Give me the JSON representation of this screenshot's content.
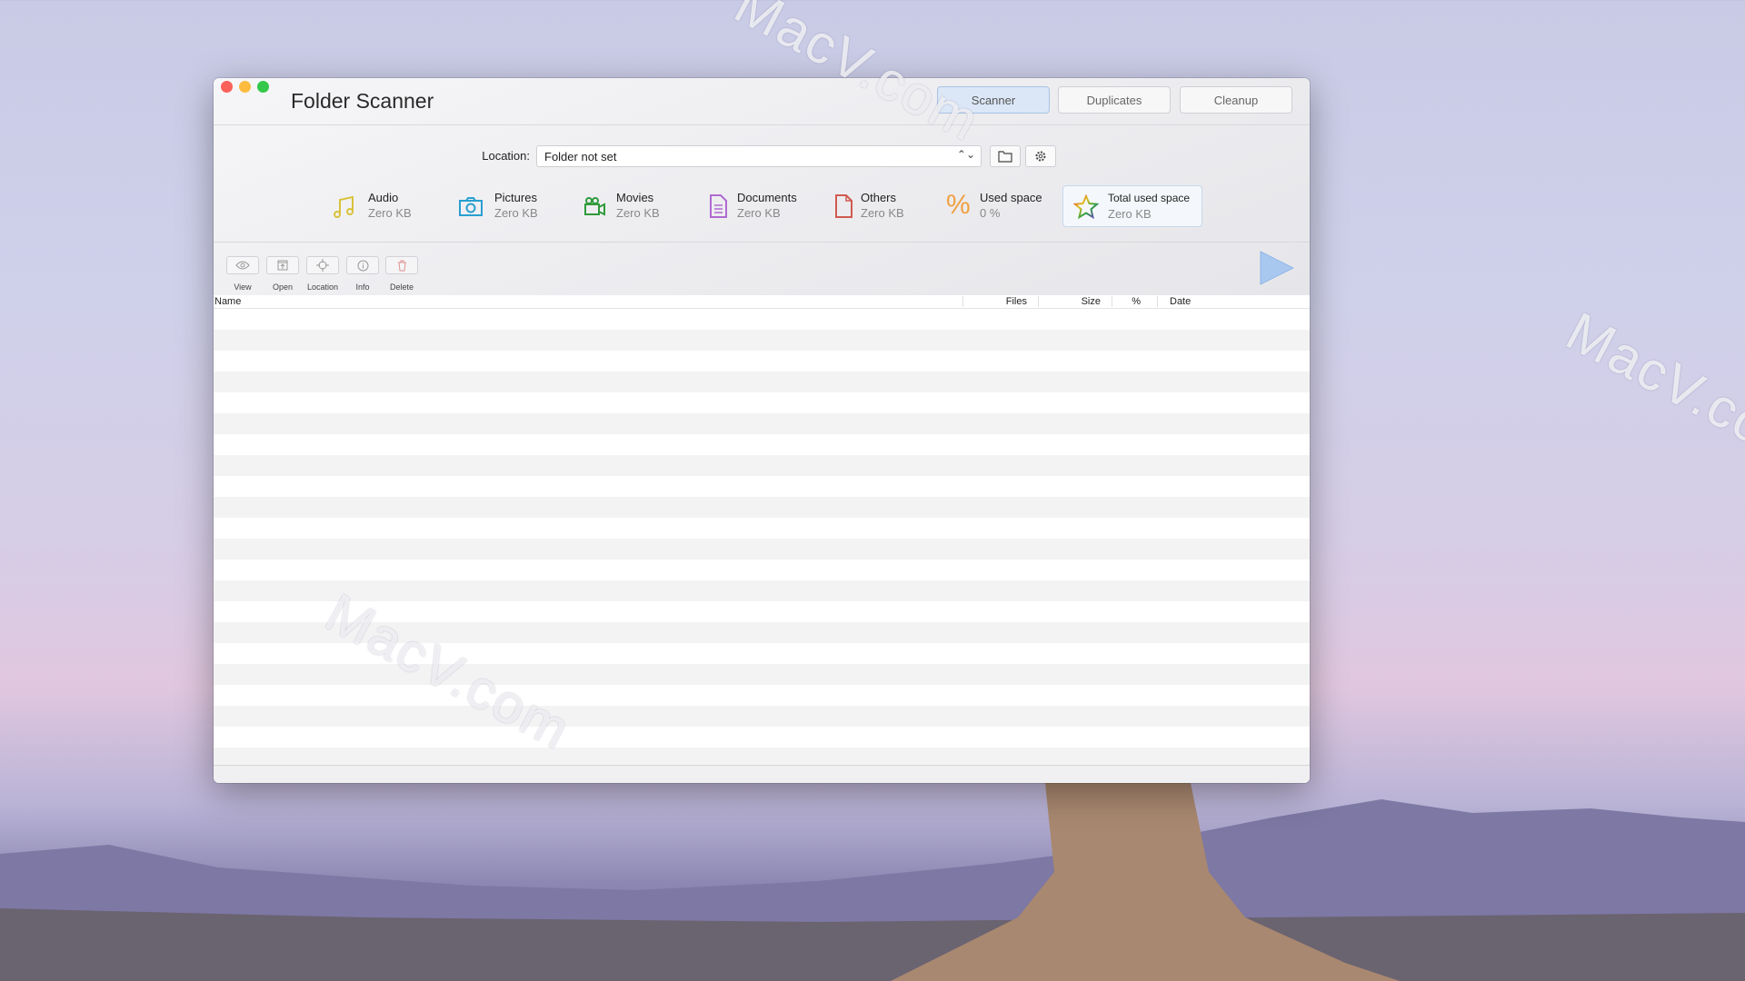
{
  "window": {
    "title": "Folder Scanner"
  },
  "tabs": [
    {
      "label": "Scanner",
      "active": true
    },
    {
      "label": "Duplicates",
      "active": false
    },
    {
      "label": "Cleanup",
      "active": false
    }
  ],
  "location": {
    "label": "Location:",
    "value": "Folder not set"
  },
  "categories": [
    {
      "name": "Audio",
      "value": "Zero KB",
      "icon": "music-note-icon",
      "color": "#d8c23a"
    },
    {
      "name": "Pictures",
      "value": "Zero KB",
      "icon": "camera-icon",
      "color": "#2a9fd0"
    },
    {
      "name": "Movies",
      "value": "Zero KB",
      "icon": "video-camera-icon",
      "color": "#2f9a3a"
    },
    {
      "name": "Documents",
      "value": "Zero KB",
      "icon": "document-icon",
      "color": "#b06ad0"
    },
    {
      "name": "Others",
      "value": "Zero KB",
      "icon": "file-icon",
      "color": "#d05a50"
    },
    {
      "name": "Used space",
      "value": "0 %",
      "icon": "percent-icon",
      "color": "#f0a040"
    },
    {
      "name": "Total used space",
      "value": "Zero KB",
      "icon": "star-icon",
      "color": "#e04040"
    }
  ],
  "toolbar": [
    {
      "label": "View",
      "icon": "eye-icon"
    },
    {
      "label": "Open",
      "icon": "open-icon"
    },
    {
      "label": "Location",
      "icon": "crosshair-icon"
    },
    {
      "label": "Info",
      "icon": "info-icon"
    },
    {
      "label": "Delete",
      "icon": "trash-icon"
    }
  ],
  "table": {
    "columns": [
      "Name",
      "Files",
      "Size",
      "%",
      "Date"
    ],
    "rows": []
  },
  "watermarks": [
    "MacV.com",
    "MacV.com",
    "MacV.com"
  ]
}
